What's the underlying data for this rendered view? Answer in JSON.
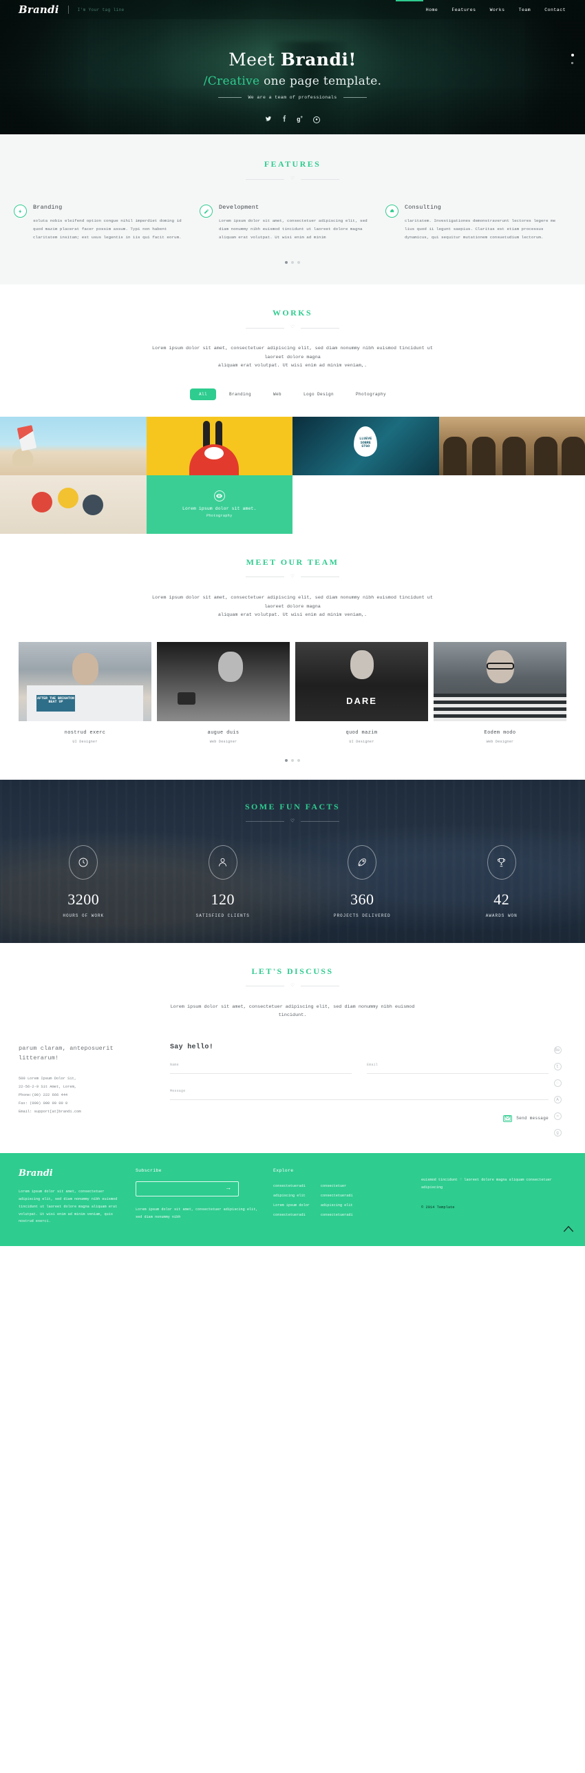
{
  "header": {
    "logo": "Brandi",
    "tagline": "I'm Your tag line",
    "nav": [
      {
        "label": "Home"
      },
      {
        "label": "Features"
      },
      {
        "label": "Works"
      },
      {
        "label": "Team"
      },
      {
        "label": "Contact"
      }
    ]
  },
  "hero": {
    "title_light": "Meet ",
    "title_bold": "Brandi!",
    "sub_accent": "/Creative",
    "sub_rest": " one page template.",
    "divider_text": "We are a team of professionals",
    "social": [
      {
        "name": "twitter-icon",
        "glyph": "✉"
      },
      {
        "name": "facebook-icon",
        "glyph": "f"
      },
      {
        "name": "google-plus-icon",
        "glyph": "g+"
      },
      {
        "name": "dribbble-icon",
        "glyph": "◌"
      }
    ]
  },
  "features": {
    "title": "FEATURES",
    "items": [
      {
        "icon": "flash-icon",
        "glyph": "⚡",
        "heading": "Branding",
        "text": "soluta nobis eleifend option congue nihil imperdiet doming id quod mazim placerat facer possim assum. Typi non habent claritatem insitam; est usus legentis in iis qui facit eorum."
      },
      {
        "icon": "pencil-icon",
        "glyph": "✎",
        "heading": "Development",
        "text": "Lorem ipsum dolor sit amet, consectetuer adipiscing elit, sed diam nonummy nibh euismod tincidunt ut laoreet dolore magna aliquam erat volutpat. Ut wisi enim ad minim"
      },
      {
        "icon": "rocket-icon",
        "glyph": "➤",
        "heading": "Consulting",
        "text": "claritatem. Investigationes demonstraverunt lectores legere me lius quod ii legunt saepius. Claritas est etiam processus dynamicus, qui sequitur mutationem consuetudium lectorum."
      }
    ]
  },
  "works": {
    "title": "WORKS",
    "lead_line1": "Lorem ipsum dolor sit amet, consectetuer adipiscing elit, sed diam nonummy nibh euismod tincidunt ut",
    "lead_line2": "laoreet dolore magna",
    "lead_line3": "aliquam erat volutpat. Ut wisi enim ad minim veniam,.",
    "filters": [
      {
        "label": "All",
        "active": true
      },
      {
        "label": "Branding",
        "active": false
      },
      {
        "label": "Web",
        "active": false
      },
      {
        "label": "Logo Design",
        "active": false
      },
      {
        "label": "Photography",
        "active": false
      }
    ],
    "hover_item": {
      "icon": "eye-icon",
      "title": "Lorem ipsum dolor sit amet.",
      "category": "Photography"
    },
    "items": [
      {
        "name": "kitesurf-photo"
      },
      {
        "name": "yellow-rabbit-illustration"
      },
      {
        "name": "llueve-sobre-stgo-poster",
        "caption_line1": "LLUEVE",
        "caption_line2": "SOBRE",
        "caption_line3": "STGO"
      },
      {
        "name": "soldiers-photo"
      },
      {
        "name": "russian-dolls-photo"
      },
      {
        "name": "photography-overlay-tile"
      }
    ]
  },
  "team": {
    "title": "MEET OUR TEAM",
    "lead_line1": "Lorem ipsum dolor sit amet, consectetuer adipiscing elit, sed diam nonummy nibh euismod tincidunt ut",
    "lead_line2": "laoreet dolore magna",
    "lead_line3": "aliquam erat volutpat. Ut wisi enim ad minim veniam,.",
    "members": [
      {
        "name": "nostrud exerc",
        "role": "UI Designer",
        "shirt_text": "AFTER THE BRIGHTON BEAT UP"
      },
      {
        "name": "augue duis",
        "role": "Web Designer"
      },
      {
        "name": "quod mazim",
        "role": "UI Designer",
        "shirt_text": "DARE"
      },
      {
        "name": "Eodem modo",
        "role": "Web Designer"
      }
    ]
  },
  "facts": {
    "title": "SOME FUN FACTS",
    "items": [
      {
        "icon": "clock-icon",
        "glyph": "◷",
        "number": "3200",
        "label": "HOURS OF WORK"
      },
      {
        "icon": "user-icon",
        "glyph": "♟",
        "number": "120",
        "label": "SATISFIED CLIENTS"
      },
      {
        "icon": "rocket-icon",
        "glyph": "➲",
        "number": "360",
        "label": "PROJECTS DELIVERED"
      },
      {
        "icon": "trophy-icon",
        "glyph": "♚",
        "number": "42",
        "label": "AWARDS WON"
      }
    ]
  },
  "contact": {
    "title": "LET'S DISCUSS",
    "lead_line1": "Lorem ipsum dolor sit amet, consectetuer adipiscing elit, sed diam nonummy nibh euismod",
    "lead_line2": "tincidunt.",
    "heading": "parum claram, anteposuerit litterarum!",
    "address": [
      "500 Lorem Ipsum Dolor Sit,",
      "22-56-2-9 Sit Amet, Lorem,",
      "Phone:(00) 222 666 444",
      "Fax: (000) 000 00 00 0",
      "Email: support[at]brandi.com"
    ],
    "form_title": "Say hello!",
    "fields": {
      "name_label": "Name",
      "name_value": "",
      "email_label": "Email",
      "email_value": "",
      "message_label": "Message",
      "message_value": ""
    },
    "send_label": "Send message",
    "send_icon": "envelope-icon",
    "social": [
      {
        "name": "behance-icon",
        "glyph": "Be"
      },
      {
        "name": "twitter-icon",
        "glyph": "t"
      },
      {
        "name": "dribbble-icon",
        "glyph": "◌"
      },
      {
        "name": "behance-alt-icon",
        "glyph": "A"
      },
      {
        "name": "rss-icon",
        "glyph": "≈"
      },
      {
        "name": "google-plus-icon",
        "glyph": "g"
      }
    ]
  },
  "footer": {
    "logo": "Brandi",
    "about": "Lorem ipsum dolor sit amet, consectetuer adipiscing elit, sed diam nonummy nibh euismod tincidunt ut laoreet dolore magna aliquam erat volutpat. Ut wisi enim ad minim veniam, quis nostrud exerci.",
    "subscribe_title": "Subscribe",
    "subscribe_placeholder": "",
    "subscribe_value": "",
    "subscribe_arrow": "→",
    "subscribe_note": "Lorem ipsum dolor sit amet, consectetuer adipiscing elit, sed diam nonummy nibh",
    "explore_title": "Explore",
    "explore_col1": [
      "consectetueradi",
      "adipiscing elit",
      "Lorem ipsum dolor",
      "consectetueradi"
    ],
    "explore_col2": [
      "consectetuer",
      "consectetueradi",
      "adipiscing elit",
      "consectetueradi"
    ],
    "right_text_before": "euismod tincidunt ",
    "right_heart": "♡",
    "right_text_after": " laoreet dolore magna aliquam consectetuer adipiscing",
    "copyright": "© 2014 Template",
    "to_top_icon": "chevron-up-icon"
  }
}
